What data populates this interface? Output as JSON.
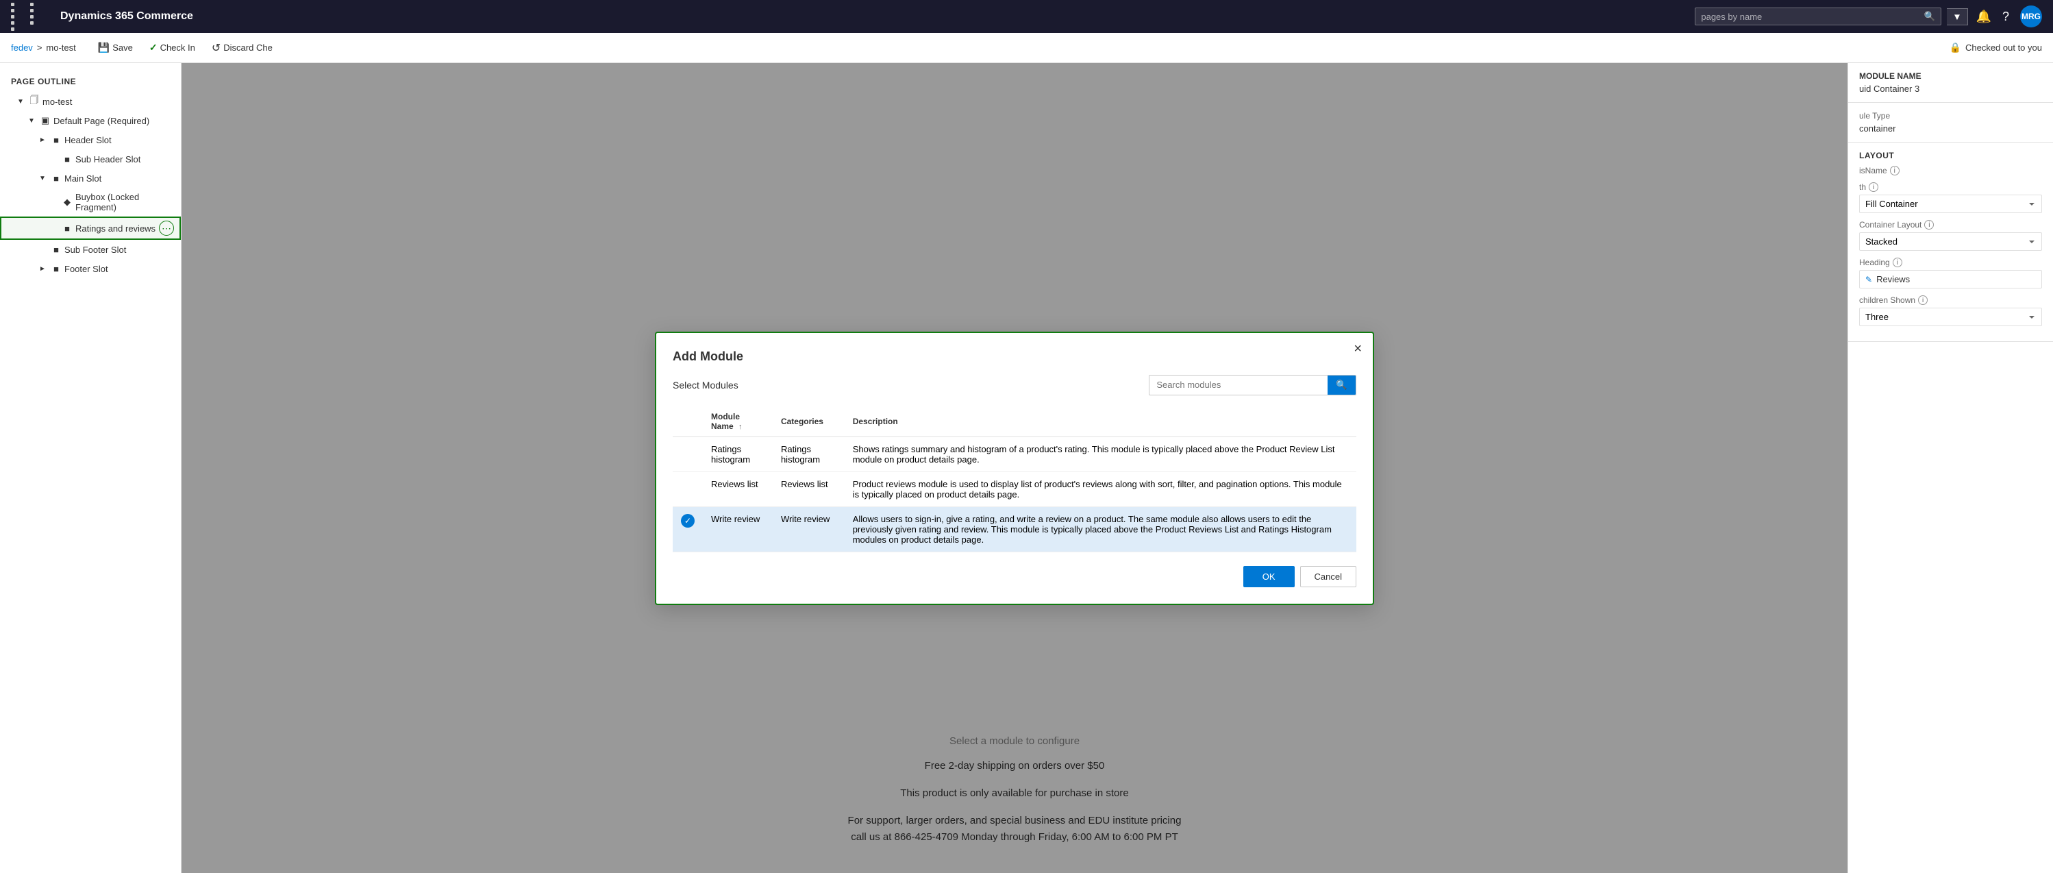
{
  "app": {
    "title": "Dynamics 365 Commerce",
    "grid_icon": "apps-icon"
  },
  "topnav": {
    "search_placeholder": "pages by name",
    "search_btn": "search-button",
    "dropdown_btn": "dropdown-button",
    "notification_icon": "notification-icon",
    "help_icon": "help-icon",
    "avatar_text": "MRG"
  },
  "toolbar": {
    "breadcrumb_root": "fedev",
    "breadcrumb_sep": ">",
    "breadcrumb_page": "mo-test",
    "save_label": "Save",
    "checkin_label": "Check In",
    "discard_label": "Discard Che",
    "checked_out_label": "Checked out to you"
  },
  "page_outline": {
    "title": "Page Outline",
    "items": [
      {
        "id": "mo-test",
        "label": "mo-test",
        "level": 0,
        "icon": "page-icon",
        "expanded": true
      },
      {
        "id": "default-page",
        "label": "Default Page (Required)",
        "level": 1,
        "icon": "layout-icon",
        "expanded": true
      },
      {
        "id": "header-slot",
        "label": "Header Slot",
        "level": 2,
        "icon": "slot-icon",
        "expanded": false
      },
      {
        "id": "sub-header-slot",
        "label": "Sub Header Slot",
        "level": 3,
        "icon": "slot-icon"
      },
      {
        "id": "main-slot",
        "label": "Main Slot",
        "level": 2,
        "icon": "slot-icon",
        "expanded": true
      },
      {
        "id": "buybox",
        "label": "Buybox (Locked Fragment)",
        "level": 3,
        "icon": "fragment-icon"
      },
      {
        "id": "ratings-reviews",
        "label": "Ratings and reviews",
        "level": 3,
        "icon": "module-icon",
        "highlighted": true
      },
      {
        "id": "sub-footer-slot",
        "label": "Sub Footer Slot",
        "level": 2,
        "icon": "slot-icon"
      },
      {
        "id": "footer-slot",
        "label": "Footer Slot",
        "level": 2,
        "icon": "slot-icon",
        "expanded": false
      }
    ]
  },
  "preview": {
    "configure_msg": "Select a module to configure",
    "shipping_text": "Free 2-day shipping on orders over $50",
    "product_text1": "This product is only available for purchase in store",
    "product_text2": "For support, larger orders, and special business and EDU institute pricing call us at 866-425-4709 Monday through Friday, 6:00 AM to 6:00 PM PT"
  },
  "right_panel": {
    "module_name_label": "MODULE NAME",
    "module_name_value": "uid Container 3",
    "module_type_label": "ule Type",
    "module_type_value": "container",
    "layout_label": "Layout",
    "layout_name_label": "isName",
    "layout_name_info": "info",
    "width_label": "th",
    "width_info": "info",
    "width_value": "Fill Container",
    "container_layout_label": "Container Layout",
    "container_layout_info": "info",
    "container_layout_value": "Stacked",
    "heading_label": "Heading",
    "heading_info": "info",
    "heading_value": "Reviews",
    "children_shown_label": "children Shown",
    "children_shown_info": "info",
    "children_shown_value": "Three"
  },
  "modal": {
    "title": "Add Module",
    "select_modules_label": "Select Modules",
    "search_placeholder": "Search modules",
    "search_btn_label": "search",
    "close_btn": "×",
    "table": {
      "headers": [
        {
          "id": "name",
          "label": "Module Name",
          "sortable": true
        },
        {
          "id": "categories",
          "label": "Categories"
        },
        {
          "id": "description",
          "label": "Description"
        }
      ],
      "rows": [
        {
          "id": "ratings-histogram",
          "name": "Ratings histogram",
          "categories": "Ratings histogram",
          "description": "Shows ratings summary and histogram of a product's rating. This module is typically placed above the Product Review List module on product details page.",
          "selected": false
        },
        {
          "id": "reviews-list",
          "name": "Reviews list",
          "categories": "Reviews list",
          "description": "Product reviews module is used to display list of product's reviews along with sort, filter, and pagination options. This module is typically placed on product details page.",
          "selected": false
        },
        {
          "id": "write-review",
          "name": "Write review",
          "categories": "Write review",
          "description": "Allows users to sign-in, give a rating, and write a review on a product. The same module also allows users to edit the previously given rating and review. This module is typically placed above the Product Reviews List and Ratings Histogram modules on product details page.",
          "selected": true
        }
      ]
    },
    "ok_label": "OK",
    "cancel_label": "Cancel"
  }
}
